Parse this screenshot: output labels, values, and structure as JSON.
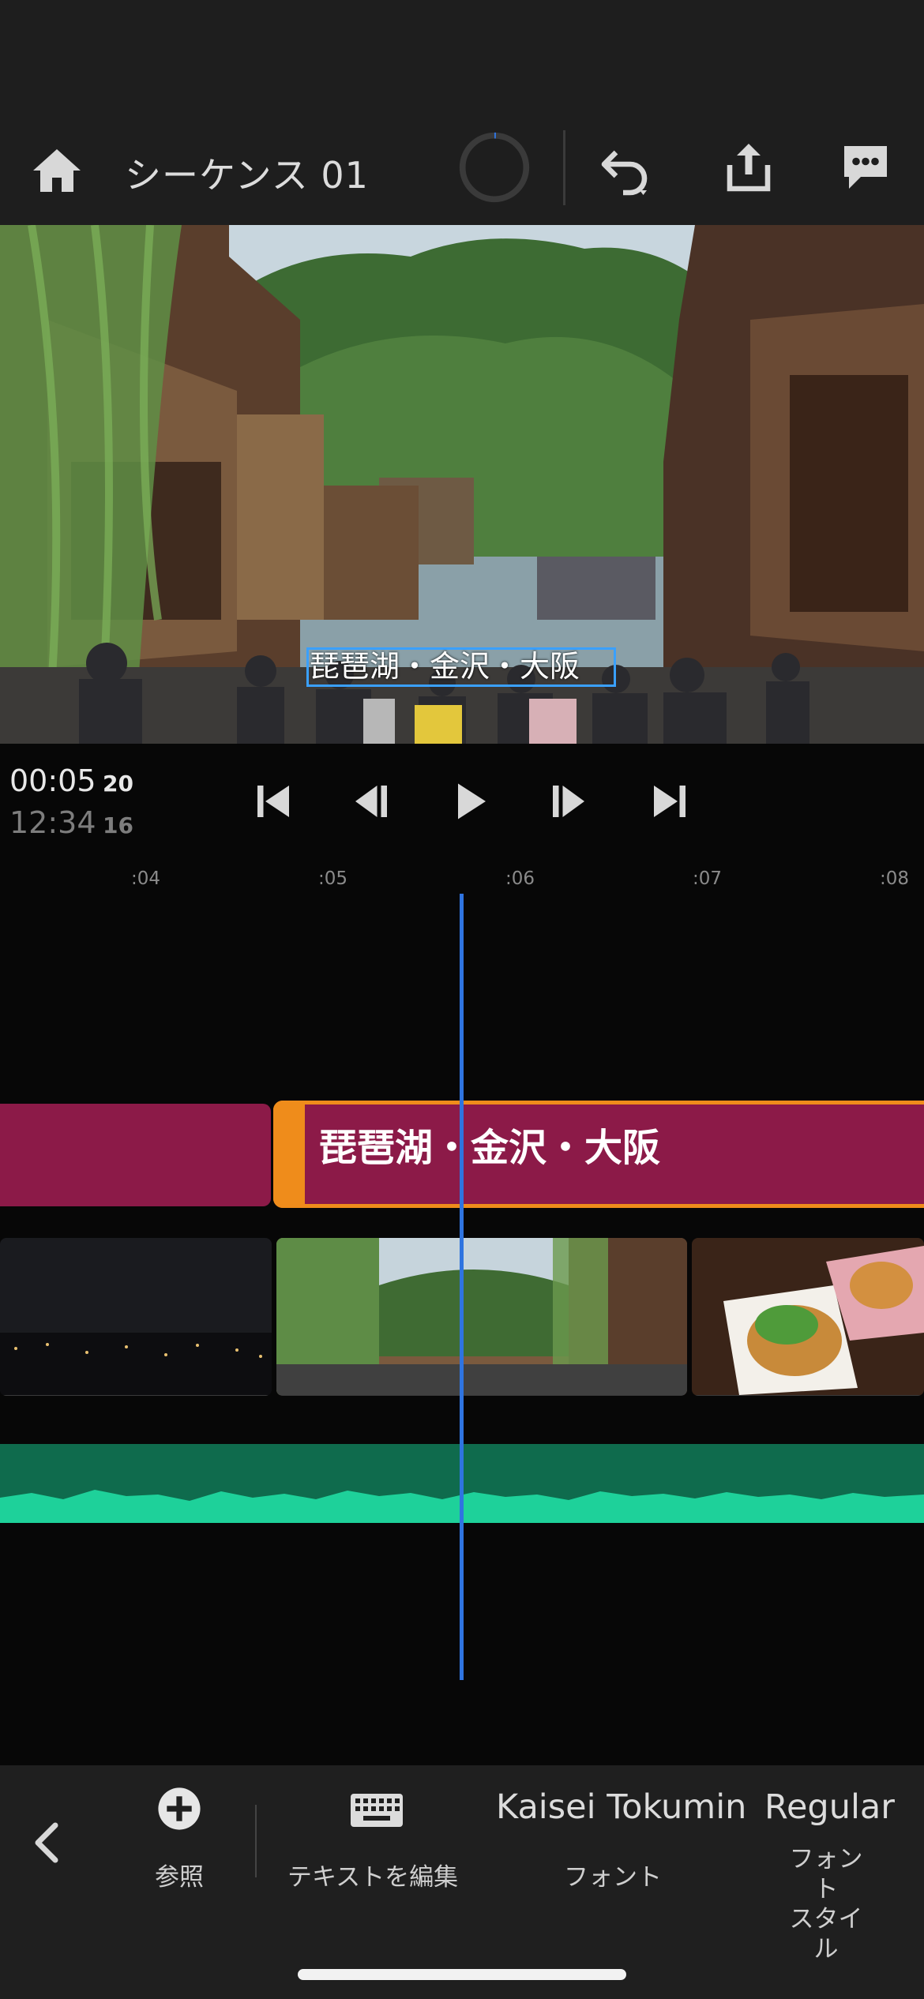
{
  "header": {
    "sequence_title": "シーケンス 01",
    "icons": [
      "home-icon",
      "progress-spinner-icon",
      "undo-icon",
      "share-icon",
      "comment-icon"
    ]
  },
  "preview": {
    "caption_text": "琵琶湖・金沢・大阪"
  },
  "transport": {
    "current_time": "00:05",
    "current_frames": "20",
    "total_time": "12:34",
    "total_frames": "16",
    "icons": [
      "skip-to-start-icon",
      "step-back-icon",
      "play-icon",
      "step-forward-icon",
      "skip-to-end-icon"
    ]
  },
  "timeline": {
    "ruler_ticks": [
      ":04",
      ":05",
      ":06",
      ":07",
      ":08"
    ],
    "title_clip_label": "琵琶湖・金沢・大阪"
  },
  "toolbar": {
    "browse_label": "参照",
    "edit_text_label": "テキストを編集",
    "font_value": "Kaisei Tokumin",
    "font_label": "フォント",
    "font_style_value": "Regular",
    "font_style_label": "フォント\nスタイル"
  },
  "colors": {
    "accent_blue": "#2f74e0",
    "title_clip": "#8c1a48",
    "clip_selection": "#ef8c1b",
    "audio_track": "#0f6b4d",
    "audio_wave": "#1ed19a"
  }
}
